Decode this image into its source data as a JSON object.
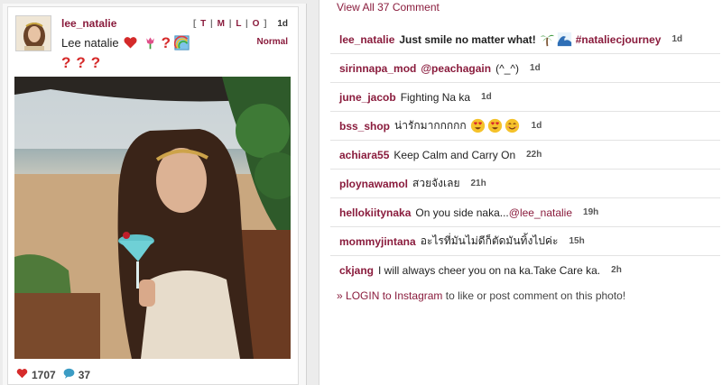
{
  "post": {
    "username": "lee_natalie",
    "caption_text": "Lee natalie",
    "caption_emojis": [
      "heart-icon",
      "tulip-icon",
      "question-mark-icon",
      "rainbow-icon"
    ],
    "caption_line2": [
      "?",
      "?",
      "?"
    ],
    "sizes": {
      "open": "[",
      "t": "T",
      "m": "M",
      "l": "L",
      "o": "O",
      "close": "]",
      "sep": "|"
    },
    "time": "1d",
    "filter": "Normal",
    "likes": "1707",
    "comments_count": "37"
  },
  "comments_header": "View All 37 Comment",
  "comments": [
    {
      "user": "lee_natalie",
      "text": "Just smile no matter what!",
      "emojis": [
        "palm-tree-icon",
        "wave-icon"
      ],
      "hashtag": "#nataliecjourney",
      "time": "1d",
      "bold": true
    },
    {
      "user": "sirinnapa_mod",
      "mention": "@peachagain",
      "text": "(^_^)",
      "time": "1d"
    },
    {
      "user": "june_jacob",
      "text": "Fighting Na ka",
      "time": "1d"
    },
    {
      "user": "bss_shop",
      "text": "น่ารักมากกกกก",
      "emojis": [
        "heart-eyes-icon",
        "heart-eyes-icon",
        "smile-icon"
      ],
      "time": "1d"
    },
    {
      "user": "achiara55",
      "text": "Keep Calm and Carry On",
      "time": "22h"
    },
    {
      "user": "ploynawamol",
      "text": "สวยจังเลย",
      "time": "21h"
    },
    {
      "user": "hellokiitynaka",
      "text": "On you side naka...",
      "mention": "@lee_natalie",
      "time": "19h"
    },
    {
      "user": "mommyjintana",
      "text": "อะไรที่มันไม่ดีก็ตัดมันทิ้งไปค่ะ",
      "time": "15h"
    },
    {
      "user": "ckjang",
      "text": "I will always cheer you on na ka.Take Care ka.",
      "time": "2h"
    }
  ],
  "login": {
    "arrow": "»",
    "link": "LOGIN to Instagram",
    "text": "to like or post comment on this photo!"
  },
  "colors": {
    "brand": "#8a1c3d",
    "heart": "#d62b2b",
    "comment_bubble": "#3b9cc4"
  }
}
